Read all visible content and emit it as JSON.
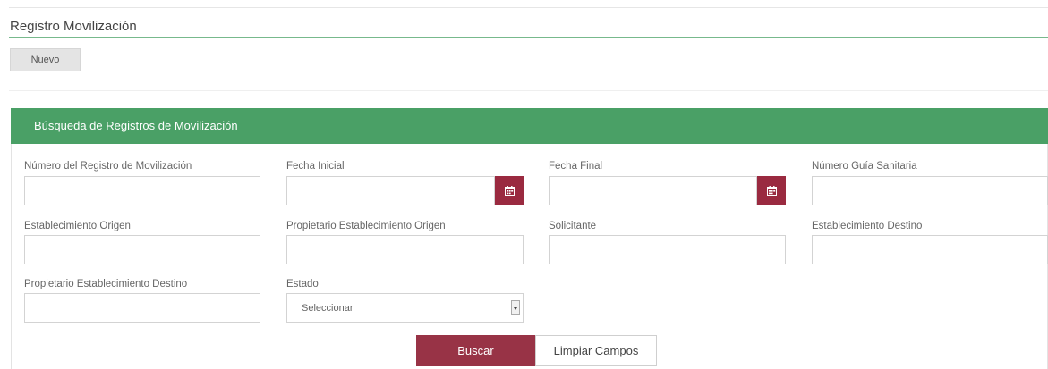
{
  "page": {
    "title": "Registro Movilización",
    "new_button": "Nuevo"
  },
  "search_panel": {
    "header": "Búsqueda de Registros de Movilización",
    "fields": {
      "numero_registro": {
        "label": "Número del Registro de Movilización",
        "value": ""
      },
      "fecha_inicial": {
        "label": "Fecha Inicial",
        "value": ""
      },
      "fecha_final": {
        "label": "Fecha Final",
        "value": ""
      },
      "numero_guia": {
        "label": "Número Guía Sanitaria",
        "value": ""
      },
      "establecimiento_origen": {
        "label": "Establecimiento Origen",
        "value": ""
      },
      "propietario_origen": {
        "label": "Propietario Establecimiento Origen",
        "value": ""
      },
      "solicitante": {
        "label": "Solicitante",
        "value": ""
      },
      "establecimiento_destino": {
        "label": "Establecimiento Destino",
        "value": ""
      },
      "propietario_destino": {
        "label": "Propietario Establecimiento Destino",
        "value": ""
      },
      "estado": {
        "label": "Estado",
        "selected": "Seleccionar"
      }
    },
    "buttons": {
      "search": "Buscar",
      "clear": "Limpiar Campos"
    }
  },
  "icons": {
    "calendar": "calendar-icon",
    "dropdown": "dropdown-arrow-icon"
  },
  "colors": {
    "header_green": "#4aa066",
    "accent_maroon": "#983346",
    "calendar_button": "#9a2a40"
  }
}
